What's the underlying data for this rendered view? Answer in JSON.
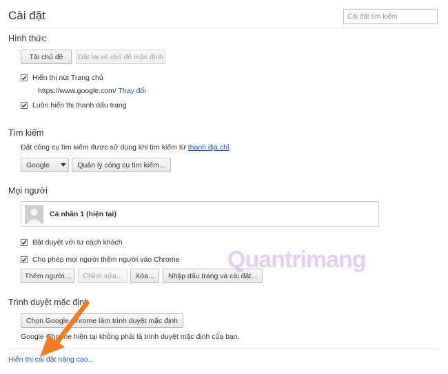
{
  "header": {
    "title": "Cài đặt",
    "search_placeholder": "Cài đặt tìm kiếm"
  },
  "appearance": {
    "section_title": "Hình thức",
    "get_themes_button": "Tải chủ đề",
    "reset_theme_button": "Đặt lại về chủ đề mặc định",
    "show_home_button_label": "Hiển thị nút Trang chủ",
    "show_home_button_checked": true,
    "home_url": "https://www.google.com/",
    "change_link": "Thay đổi",
    "show_bookmarks_bar_label": "Luôn hiển thị thanh dấu trang",
    "show_bookmarks_bar_checked": true
  },
  "search": {
    "section_title": "Tìm kiếm",
    "description_prefix": "Đặt công cụ tìm kiếm được sử dụng khi tìm kiếm từ",
    "omnibox_link": "thanh địa chỉ",
    "description_suffix": ".",
    "engine_selected": "Google",
    "manage_button": "Quản lý công cụ tìm kiếm..."
  },
  "people": {
    "section_title": "Mọi người",
    "profile_name": "Cá nhân 1 (hiện tại)",
    "guest_browsing_label": "Bật duyệt với tư cách khách",
    "guest_browsing_checked": true,
    "let_anyone_add_label": "Cho phép mọi người thêm người vào Chrome",
    "let_anyone_add_checked": true,
    "add_person_button": "Thêm người...",
    "edit_button": "Chỉnh sửa...",
    "remove_button": "Xóa...",
    "import_button": "Nhập dấu trang và cài đặt..."
  },
  "default_browser": {
    "section_title": "Trình duyệt mặc định",
    "make_default_button": "Chọn Google Chrome làm trình duyệt mặc định",
    "status_text": "Google Chrome hiện tại không phải là trình duyệt mặc định của bạn."
  },
  "footer": {
    "advanced_link": "Hiển thị cài đặt nâng cao..."
  },
  "watermark": {
    "text": "Quantrimang"
  },
  "colors": {
    "link": "#2a55c9",
    "arrow": "#f07c1e",
    "watermark": "#c9a8ee"
  },
  "icons": {
    "checkbox": "check-icon",
    "dropdown": "triangle-down-icon",
    "avatar": "default-person-icon",
    "annotation": "orange-arrow"
  }
}
